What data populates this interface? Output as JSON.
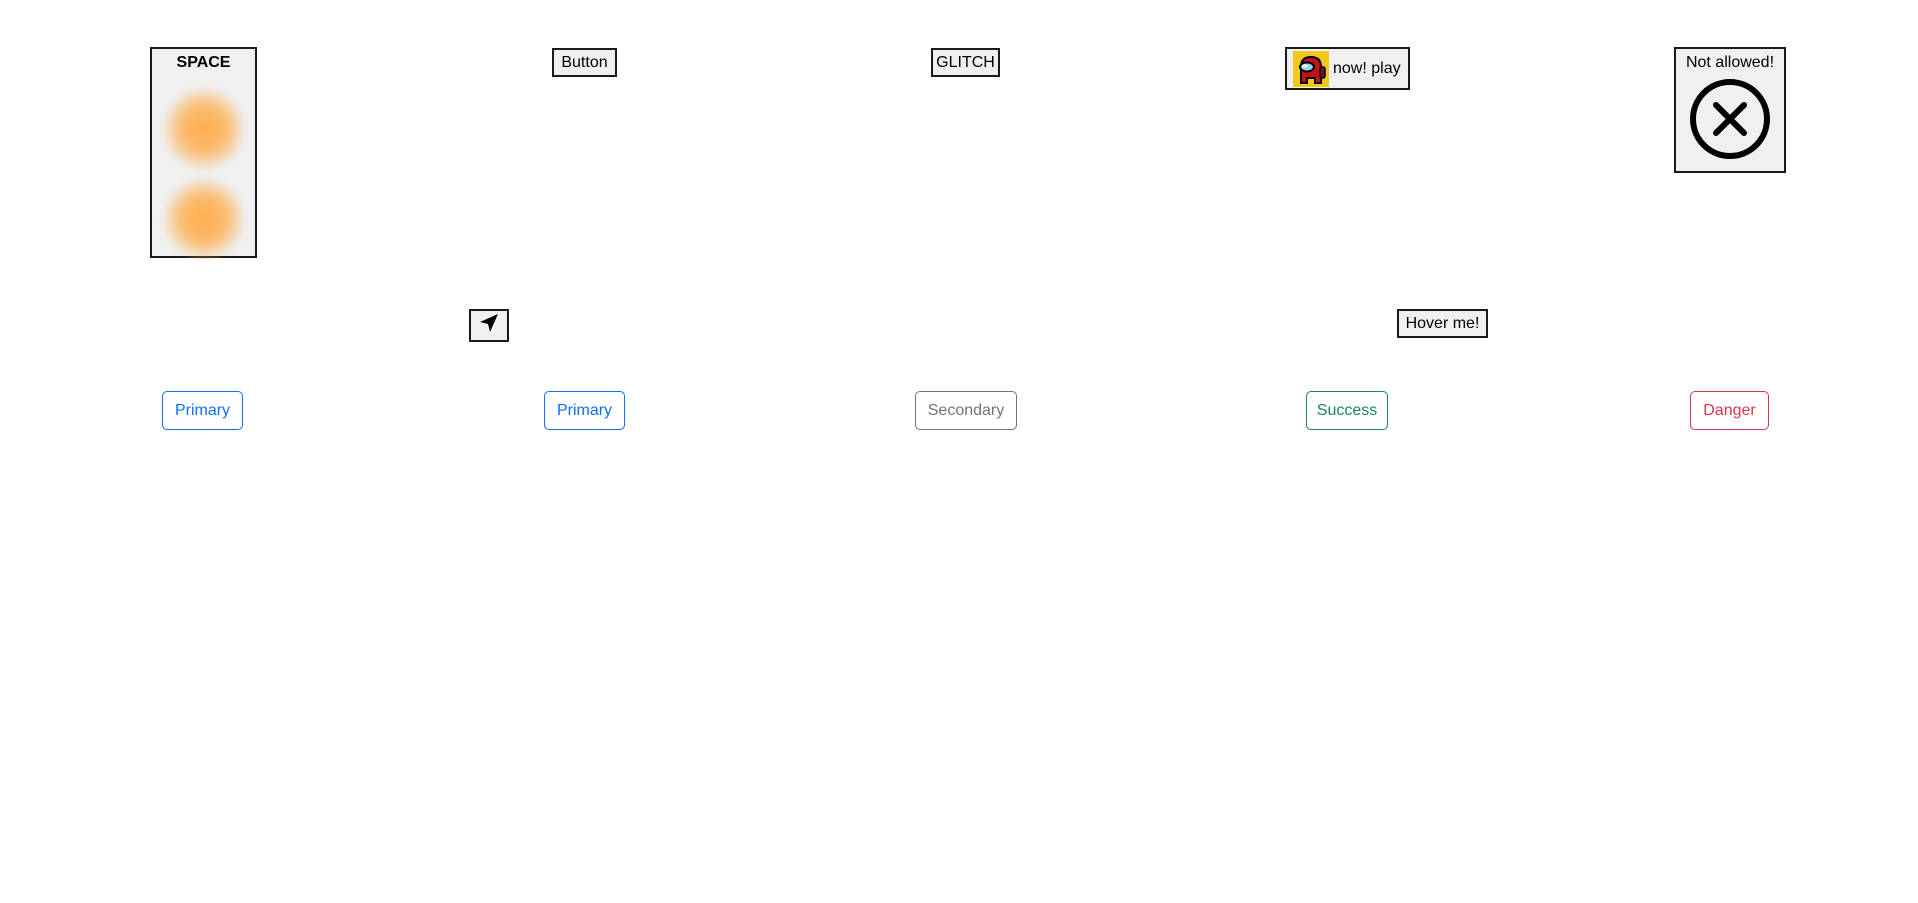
{
  "row1": {
    "space_label": "SPACE",
    "button_label": "Button",
    "glitch_label": "GLITCH",
    "play_label": "now! play",
    "not_allowed_label": "Not allowed!"
  },
  "row2": {
    "send_icon": "send-icon",
    "hover_label": "Hover me!"
  },
  "row3": {
    "primary1_label": "Primary",
    "primary2_label": "Primary",
    "secondary_label": "Secondary",
    "success_label": "Success",
    "danger_label": "Danger"
  },
  "colors": {
    "primary": "#0d6efd",
    "secondary": "#6c757d",
    "success": "#198754",
    "danger": "#dc3545",
    "glow": "#ffaa46",
    "amongus_bg": "#f2c81b",
    "amongus_body": "#c51111"
  }
}
